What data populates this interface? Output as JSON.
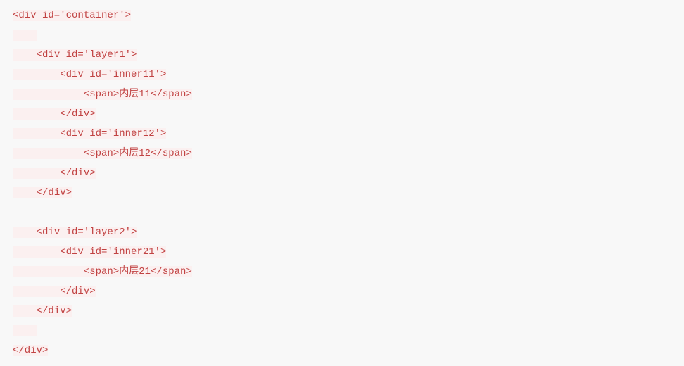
{
  "code": {
    "line1": "<div id='container'>",
    "line2": "",
    "line3": "<div id='layer1'>",
    "line4": "<div id='inner11'>",
    "line5": "<span>内层11</span>",
    "line6": "</div>",
    "line7": "<div id='inner12'>",
    "line8": "<span>内层12</span>",
    "line9": "</div>",
    "line10": "</div>",
    "line11": "",
    "line12": "<div id='layer2'>",
    "line13": "<div id='inner21'>",
    "line14": "<span>内层21</span>",
    "line15": "</div>",
    "line16": "</div>",
    "line17": "",
    "line18": "</div>"
  }
}
